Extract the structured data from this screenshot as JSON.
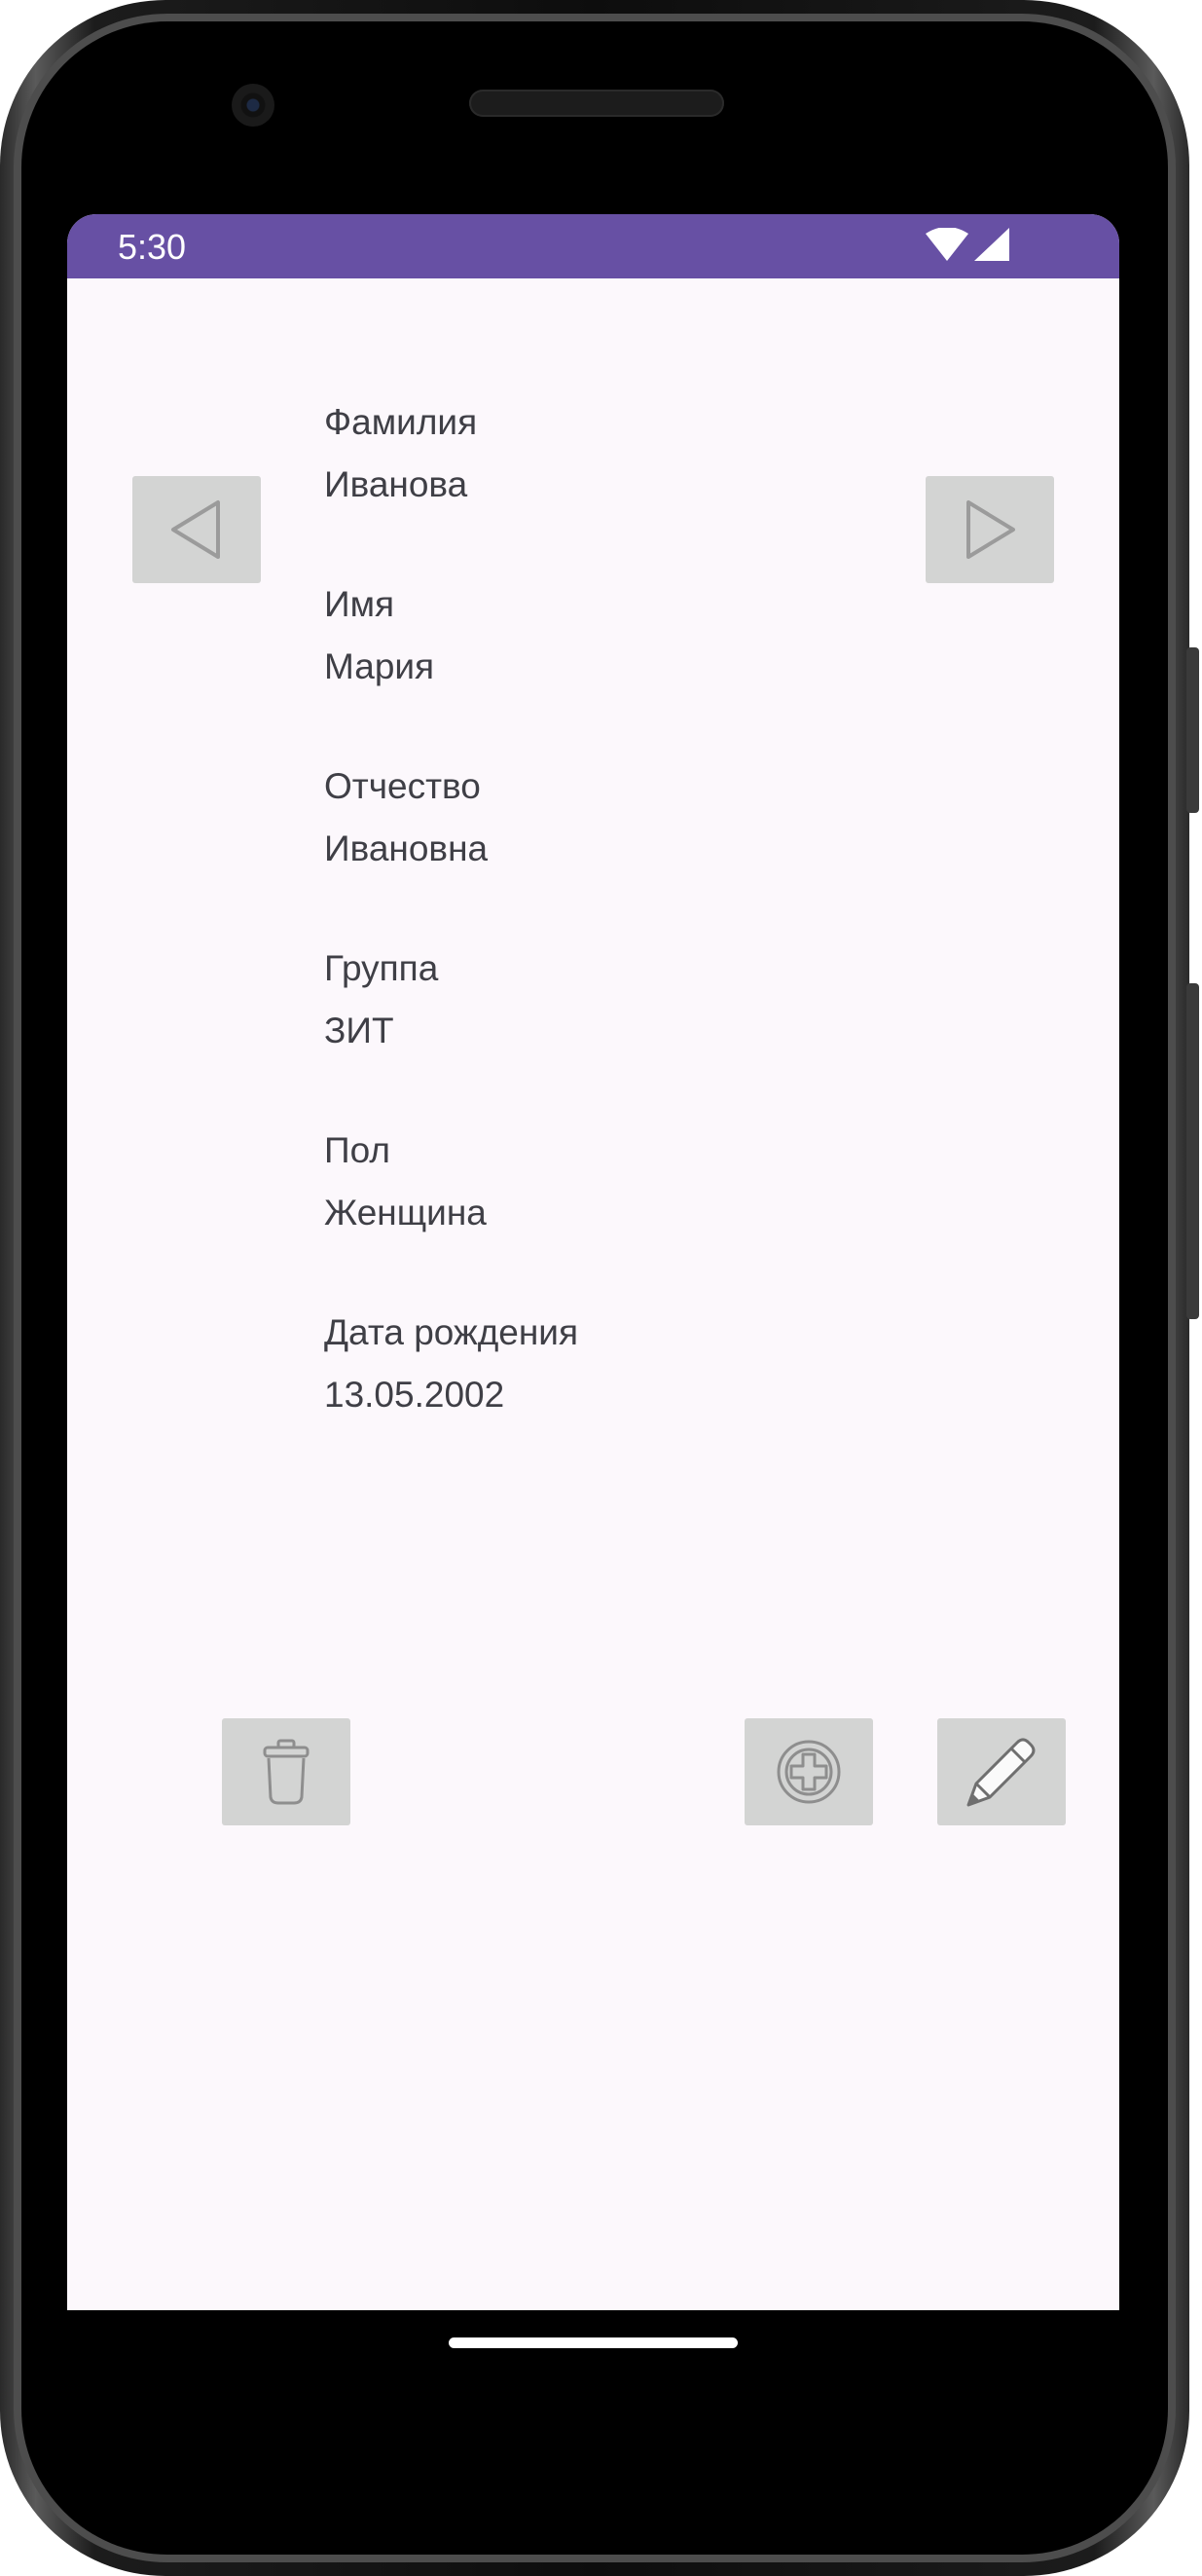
{
  "status_bar": {
    "time": "5:30",
    "background": "#6750a4"
  },
  "fields": [
    {
      "label": "Фамилия",
      "value": "Иванова"
    },
    {
      "label": "Имя",
      "value": "Мария"
    },
    {
      "label": "Отчество",
      "value": "Ивановна"
    },
    {
      "label": "Группа",
      "value": "ЗИТ"
    },
    {
      "label": "Пол",
      "value": "Женщина"
    },
    {
      "label": "Дата рождения",
      "value": "13.05.2002"
    }
  ],
  "buttons": {
    "previous": {
      "icon": "triangle-left-icon"
    },
    "next": {
      "icon": "triangle-right-icon"
    },
    "delete": {
      "icon": "trash-icon"
    },
    "add": {
      "icon": "plus-circle-icon"
    },
    "edit": {
      "icon": "pencil-icon"
    }
  },
  "colors": {
    "screen_background": "#fcf8fc",
    "button_background": "#d3d4d3",
    "text": "#3f3f46"
  }
}
